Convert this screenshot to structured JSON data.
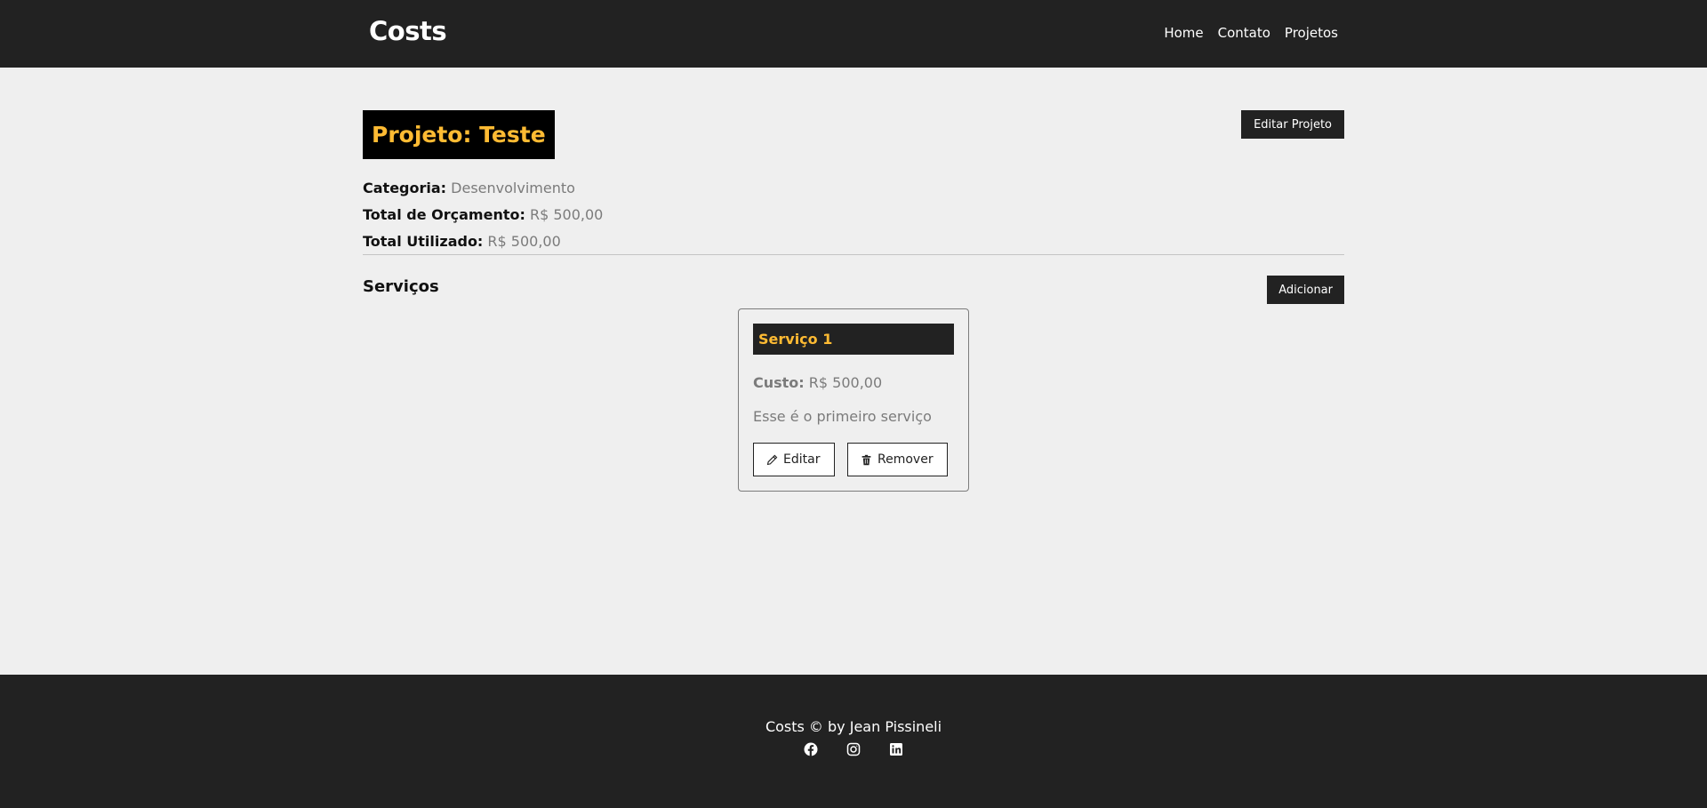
{
  "navbar": {
    "brand": "Costs",
    "links": [
      "Home",
      "Contato",
      "Projetos"
    ]
  },
  "project": {
    "title": "Projeto: Teste",
    "edit_button": "Editar Projeto",
    "category_label": "Categoria:",
    "category_value": "Desenvolvimento",
    "budget_label": "Total de Orçamento:",
    "budget_value": "R$ 500,00",
    "used_label": "Total Utilizado:",
    "used_value": "R$ 500,00"
  },
  "services": {
    "title": "Serviços",
    "add_button": "Adicionar",
    "items": [
      {
        "name": "Serviço 1",
        "cost_label": "Custo:",
        "cost_value": "R$ 500,00",
        "description": "Esse é o primeiro serviço",
        "edit_label": "Editar",
        "remove_label": "Remover"
      }
    ]
  },
  "footer": {
    "copyright": "Costs © by Jean Pissineli",
    "icons": [
      "facebook-icon",
      "instagram-icon",
      "linkedin-icon"
    ]
  },
  "colors": {
    "dark": "#222222",
    "accent": "#ffbb33",
    "background": "#efefef",
    "muted_text": "#7b7b7b"
  }
}
